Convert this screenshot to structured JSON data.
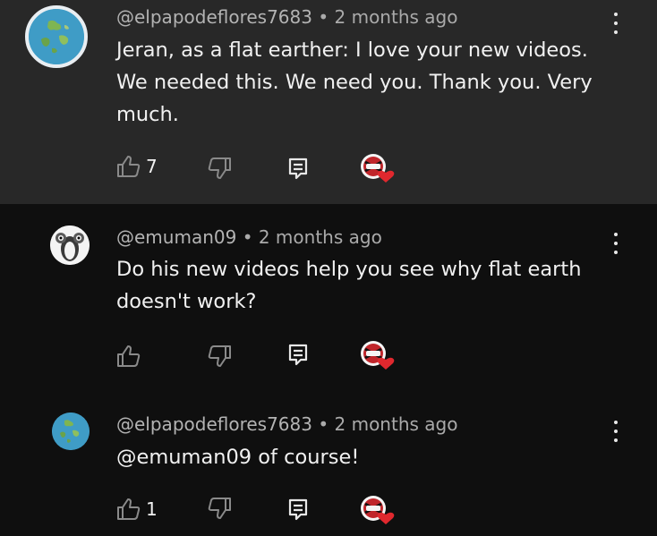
{
  "comments": [
    {
      "author": "@elpapodeflores7683",
      "separator": "•",
      "time": "2 months ago",
      "text": "Jeran, as a flat earther: I love your new videos. We needed this. We need you. Thank you. Very much.",
      "likes": "7",
      "avatar": "globe-icon",
      "highlighted": true
    },
    {
      "author": "@emuman09",
      "separator": "•",
      "time": "2 months ago",
      "text": "Do his new videos help you see why flat earth doesn't work?",
      "likes": "",
      "avatar": "penguin-icon",
      "highlighted": false
    },
    {
      "author": "@elpapodeflores7683",
      "separator": "•",
      "time": "2 months ago",
      "text": "@emuman09  of course!",
      "likes": "1",
      "avatar": "globe-icon",
      "highlighted": false
    }
  ],
  "colors": {
    "background": "#0f0f0f",
    "highlight": "#282828",
    "text": "#f1f1f1",
    "meta": "#aaaaaa",
    "heart": "#e0282e"
  },
  "icons": {
    "like": "thumbs-up-icon",
    "dislike": "thumbs-down-icon",
    "reply": "reply-icon",
    "creator_heart": "creator-heart-icon",
    "menu": "more-vertical-icon"
  }
}
